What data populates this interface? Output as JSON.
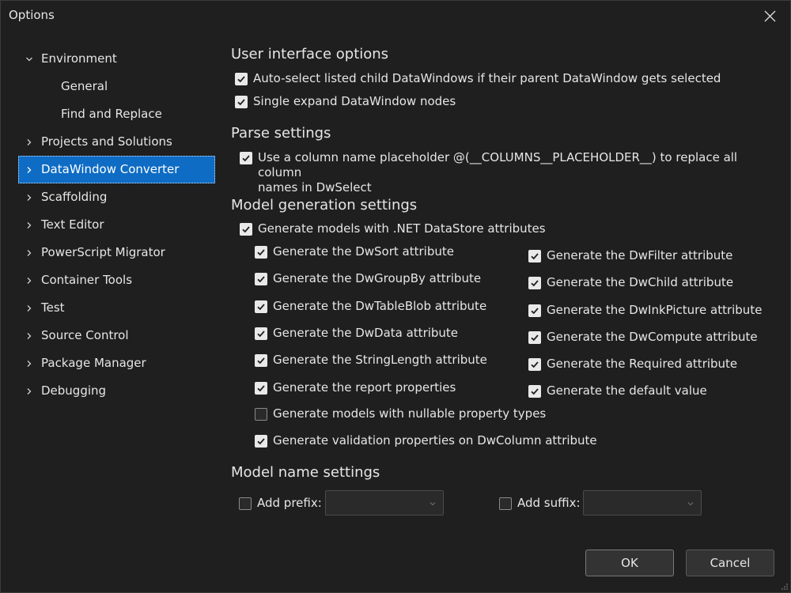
{
  "window": {
    "title": "Options"
  },
  "sidebar": {
    "items": [
      {
        "label": "Environment",
        "expanded": true,
        "level": 0
      },
      {
        "label": "General",
        "level": 1
      },
      {
        "label": "Find and Replace",
        "level": 1
      },
      {
        "label": "Projects and Solutions",
        "level": 0
      },
      {
        "label": "DataWindow Converter",
        "level": 0,
        "selected": true
      },
      {
        "label": "Scaffolding",
        "level": 0
      },
      {
        "label": "Text Editor",
        "level": 0
      },
      {
        "label": "PowerScript Migrator",
        "level": 0
      },
      {
        "label": "Container Tools",
        "level": 0
      },
      {
        "label": "Test",
        "level": 0
      },
      {
        "label": "Source Control",
        "level": 0
      },
      {
        "label": "Package Manager",
        "level": 0
      },
      {
        "label": "Debugging",
        "level": 0
      }
    ]
  },
  "ui_options": {
    "title": "User interface options",
    "auto_select": {
      "label": "Auto-select listed child DataWindows if their parent DataWindow gets selected",
      "checked": true
    },
    "single_expand": {
      "label": "Single expand DataWindow nodes",
      "checked": true
    }
  },
  "parse_settings": {
    "title": "Parse settings",
    "placeholder": {
      "label_line1": "Use a column name placeholder @(__COLUMNS__PLACEHOLDER__) to replace all column",
      "label_line2": "names in DwSelect",
      "checked": true
    }
  },
  "model_generation": {
    "title": "Model generation settings",
    "datastore_attrs": {
      "label": "Generate models with .NET DataStore attributes",
      "checked": true
    },
    "left": [
      {
        "label": "Generate the DwSort attribute",
        "checked": true
      },
      {
        "label": "Generate the DwGroupBy attribute",
        "checked": true
      },
      {
        "label": "Generate the DwTableBlob attribute",
        "checked": true
      },
      {
        "label": "Generate the DwData attribute",
        "checked": true
      },
      {
        "label": "Generate the StringLength attribute",
        "checked": true
      },
      {
        "label": "Generate the report properties",
        "checked": true
      },
      {
        "label": "Generate models with nullable property types",
        "checked": false
      },
      {
        "label": "Generate validation properties on DwColumn attribute",
        "checked": true
      }
    ],
    "right": [
      {
        "label": "Generate the DwFilter attribute",
        "checked": true
      },
      {
        "label": "Generate the DwChild attribute",
        "checked": true
      },
      {
        "label": "Generate the DwInkPicture attribute",
        "checked": true
      },
      {
        "label": "Generate the DwCompute attribute",
        "checked": true
      },
      {
        "label": "Generate the Required attribute",
        "checked": true
      },
      {
        "label": "Generate the default value",
        "checked": true
      }
    ]
  },
  "model_name": {
    "title": "Model name settings",
    "prefix": {
      "label": "Add prefix:",
      "checked": false,
      "value": ""
    },
    "suffix": {
      "label": "Add suffix:",
      "checked": false,
      "value": ""
    }
  },
  "footer": {
    "ok_label": "OK",
    "cancel_label": "Cancel"
  },
  "colors": {
    "background": "#1f1f1f",
    "accent": "#0e6cc4",
    "text": "#e6e6e6"
  }
}
